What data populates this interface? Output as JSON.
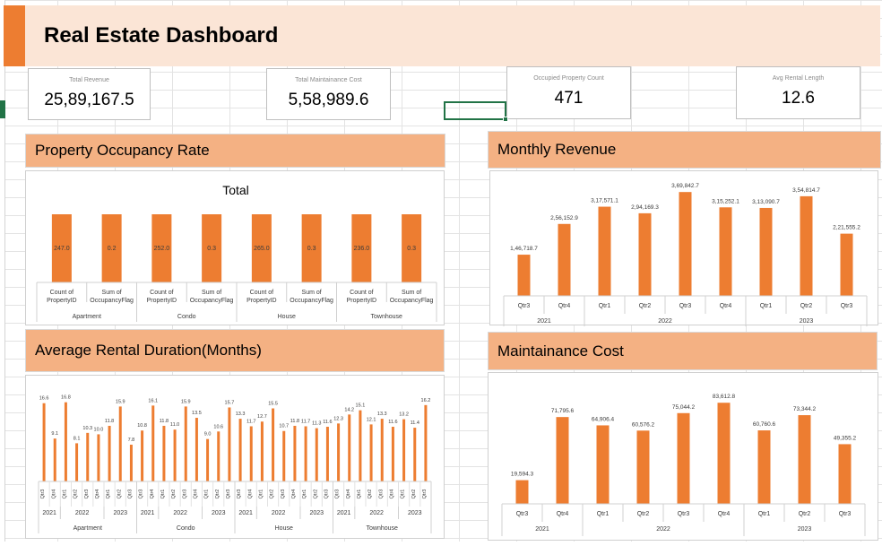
{
  "dashboard": {
    "title": "Real Estate Dashboard"
  },
  "kpis": {
    "total_revenue": {
      "label": "Total Revenue",
      "value": "25,89,167.5"
    },
    "total_maintenance": {
      "label": "Total Maintainance Cost",
      "value": "5,58,989.6"
    },
    "occupied_count": {
      "label": "Occupied Property Count",
      "value": "471"
    },
    "avg_rental": {
      "label": "Avg Rental Length",
      "value": "12.6"
    }
  },
  "sections": {
    "occupancy": "Property Occupancy Rate",
    "monthly_revenue": "Monthly Revenue",
    "avg_duration": "Average Rental Duration(Months)",
    "maintenance": "Maintainance Cost"
  },
  "colors": {
    "accent": "#ED7D31",
    "header_fill": "#F4B183",
    "title_fill": "#FBE5D6"
  },
  "chart_data": [
    {
      "id": "occupancy",
      "type": "bar",
      "title": "Total",
      "groups": [
        "Apartment",
        "Condo",
        "House",
        "Townhouse"
      ],
      "categories": [
        "Count of PropertyID",
        "Sum of OccupancyFlag"
      ],
      "values": [
        247.0,
        0.2,
        252.0,
        0.3,
        265.0,
        0.3,
        236.0,
        0.3
      ],
      "labels": [
        "247.0",
        "0.2",
        "252.0",
        "0.3",
        "265.0",
        "0.3",
        "236.0",
        "0.3"
      ]
    },
    {
      "id": "monthly_revenue",
      "type": "bar",
      "quarters": [
        "Qtr3",
        "Qtr4",
        "Qtr1",
        "Qtr2",
        "Qtr3",
        "Qtr4",
        "Qtr1",
        "Qtr2",
        "Qtr3"
      ],
      "years": [
        {
          "label": "2021",
          "span": 2
        },
        {
          "label": "2022",
          "span": 4
        },
        {
          "label": "2023",
          "span": 3
        }
      ],
      "values": [
        146718.7,
        256152.9,
        317571.1,
        294169.3,
        369842.7,
        315252.1,
        313090.7,
        354814.7,
        221555.2
      ],
      "labels": [
        "1,46,718.7",
        "2,56,152.9",
        "3,17,571.1",
        "2,94,169.3",
        "3,69,842.7",
        "3,15,252.1",
        "3,13,090.7",
        "3,54,814.7",
        "2,21,555.2"
      ]
    },
    {
      "id": "avg_duration",
      "type": "bar",
      "groups": [
        {
          "label": "Apartment",
          "years": [
            {
              "label": "2021",
              "span": 2
            },
            {
              "label": "2022",
              "span": 4
            },
            {
              "label": "2023",
              "span": 3
            }
          ]
        },
        {
          "label": "Condo",
          "years": [
            {
              "label": "2021",
              "span": 2
            },
            {
              "label": "2022",
              "span": 4
            },
            {
              "label": "2023",
              "span": 3
            }
          ]
        },
        {
          "label": "House",
          "years": [
            {
              "label": "2021",
              "span": 2
            },
            {
              "label": "2022",
              "span": 4
            },
            {
              "label": "2023",
              "span": 3
            }
          ]
        },
        {
          "label": "Townhouse",
          "years": [
            {
              "label": "2021",
              "span": 2
            },
            {
              "label": "2022",
              "span": 4
            },
            {
              "label": "2023",
              "span": 3
            }
          ]
        }
      ],
      "quarters": [
        "Qtr3",
        "Qtr4",
        "Qtr1",
        "Qtr2",
        "Qtr3",
        "Qtr4",
        "Qtr1",
        "Qtr2",
        "Qtr3"
      ],
      "values": [
        16.6,
        9.1,
        16.8,
        8.1,
        10.3,
        10.0,
        11.8,
        15.9,
        7.8,
        10.8,
        16.1,
        11.8,
        11.0,
        15.9,
        13.5,
        9.0,
        10.6,
        15.7,
        13.3,
        11.7,
        12.7,
        15.5,
        10.7,
        11.8,
        11.7,
        11.3,
        11.6,
        12.3,
        14.2,
        15.1,
        12.1,
        13.3,
        11.6,
        13.2,
        11.4,
        16.2
      ],
      "labels": [
        "16.6",
        "9.1",
        "16.8",
        "8.1",
        "10.3",
        "10.0",
        "11.8",
        "15.9",
        "7.8",
        "10.8",
        "16.1",
        "11.8",
        "11.0",
        "15.9",
        "13.5",
        "9.0",
        "10.6",
        "15.7",
        "13.3",
        "11.7",
        "12.7",
        "15.5",
        "10.7",
        "11.8",
        "11.7",
        "11.3",
        "11.6",
        "12.3",
        "14.2",
        "15.1",
        "12.1",
        "13.3",
        "11.6",
        "13.2",
        "11.4",
        "16.2"
      ]
    },
    {
      "id": "maintenance",
      "type": "bar",
      "quarters": [
        "Qtr3",
        "Qtr4",
        "Qtr1",
        "Qtr2",
        "Qtr3",
        "Qtr4",
        "Qtr1",
        "Qtr2",
        "Qtr3"
      ],
      "years": [
        {
          "label": "2021",
          "span": 2
        },
        {
          "label": "2022",
          "span": 4
        },
        {
          "label": "2023",
          "span": 3
        }
      ],
      "values": [
        19594.3,
        71795.6,
        64906.4,
        60576.2,
        75044.2,
        83612.8,
        60760.6,
        73344.2,
        49355.2
      ],
      "labels": [
        "19,594.3",
        "71,795.6",
        "64,906.4",
        "60,576.2",
        "75,044.2",
        "83,612.8",
        "60,760.6",
        "73,344.2",
        "49,355.2"
      ]
    }
  ]
}
